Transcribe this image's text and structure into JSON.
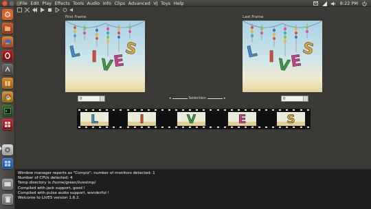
{
  "menubar": {
    "items": [
      "File",
      "Edit",
      "Play",
      "Effects",
      "Tools",
      "Audio",
      "Info",
      "Clips",
      "Advanced",
      "VJ",
      "Toys",
      "Help"
    ]
  },
  "panel": {
    "clock": "8:22 PM",
    "indicators": [
      "mail-icon",
      "network-icon",
      "volume-icon",
      "power-icon"
    ]
  },
  "main": {
    "first_frame_label": "First Frame",
    "last_frame_label": "Last Frame",
    "start_value": "0",
    "end_value": "0",
    "selection_label": "Selection"
  },
  "thumbs": [
    {
      "letter": "L",
      "color": "#3c8fd0"
    },
    {
      "letter": "I",
      "color": "#e14b2a"
    },
    {
      "letter": "V",
      "color": "#3e9b3e"
    },
    {
      "letter": "E",
      "color": "#d23a8c"
    },
    {
      "letter": "S",
      "color": "#e0a82e"
    }
  ],
  "console": {
    "lines": [
      "Window manager reports as \"Compiz\"; number of monitors detected: 1",
      "Number of CPUs detected: 4",
      "Temp directory is /home/green/livestmp/",
      "Compiled with jack support, good !",
      "Compiled with pulse audio support, wonderful !",
      "Welcome to LiVES version 1.6.2."
    ]
  },
  "colors": {
    "panel_bg": "#3c3b37",
    "console_bg": "#1e1e1e",
    "close_btn": "#e8593a"
  }
}
